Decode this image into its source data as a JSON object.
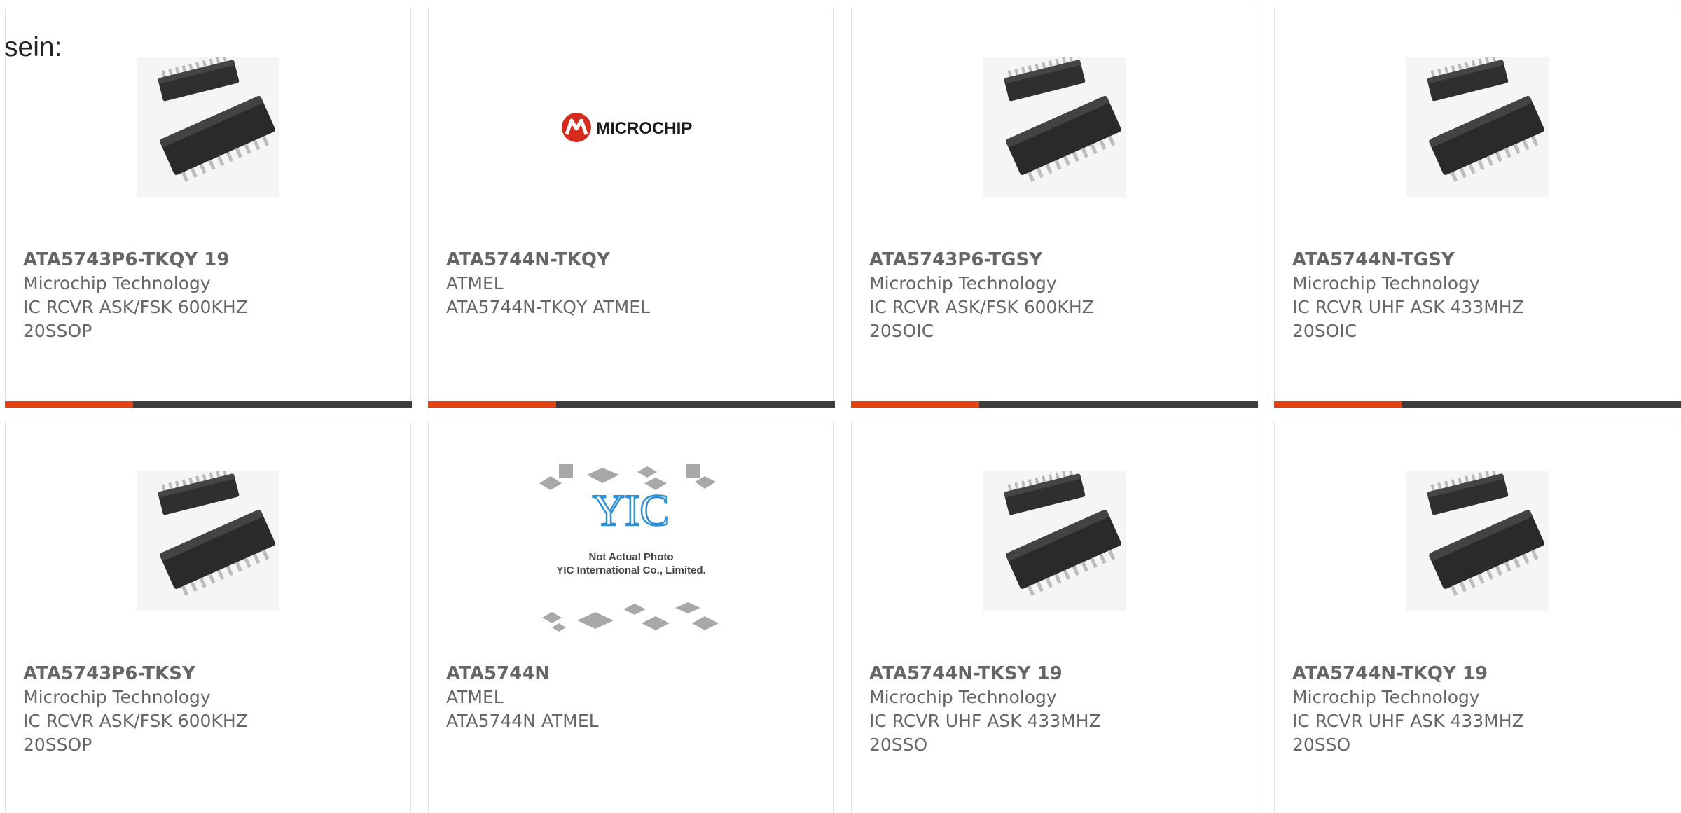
{
  "intro_text": "sein:",
  "colors": {
    "accent": "#e8410f",
    "bar_dark": "#3d3d3d",
    "card_border": "#e3e3e3",
    "text": "#666666",
    "microchip_red": "#d52b1e",
    "yic_blue": "#2d8fd5"
  },
  "products": [
    {
      "part": "ATA5743P6-TKQY 19",
      "maker": "Microchip Technology",
      "desc1": "IC RCVR ASK/FSK 600KHZ",
      "desc2": "20SSOP",
      "image": "ic-chip-photo"
    },
    {
      "part": "ATA5744N-TKQY",
      "maker": "ATMEL",
      "desc1": "ATA5744N-TKQY ATMEL",
      "desc2": "",
      "image": "microchip-logo",
      "logo_text": "MICROCHIP"
    },
    {
      "part": "ATA5743P6-TGSY",
      "maker": "Microchip Technology",
      "desc1": "IC RCVR ASK/FSK 600KHZ",
      "desc2": "20SOIC",
      "image": "ic-chip-photo"
    },
    {
      "part": "ATA5744N-TGSY",
      "maker": "Microchip Technology",
      "desc1": "IC RCVR UHF ASK 433MHZ",
      "desc2": "20SOIC",
      "image": "ic-chip-photo"
    },
    {
      "part": "ATA5743P6-TKSY",
      "maker": "Microchip Technology",
      "desc1": "IC RCVR ASK/FSK 600KHZ",
      "desc2": "20SSOP",
      "image": "ic-chip-photo"
    },
    {
      "part": "ATA5744N",
      "maker": "ATMEL",
      "desc1": "ATA5744N ATMEL",
      "desc2": "",
      "image": "yic-placeholder",
      "photo_note_1": "Not Actual Photo",
      "photo_note_2": "YIC International Co., Limited."
    },
    {
      "part": "ATA5744N-TKSY 19",
      "maker": "Microchip Technology",
      "desc1": "IC RCVR UHF ASK 433MHZ",
      "desc2": "20SSO",
      "image": "ic-chip-photo"
    },
    {
      "part": "ATA5744N-TKQY 19",
      "maker": "Microchip Technology",
      "desc1": "IC RCVR UHF ASK 433MHZ",
      "desc2": "20SSO",
      "image": "ic-chip-photo"
    }
  ]
}
